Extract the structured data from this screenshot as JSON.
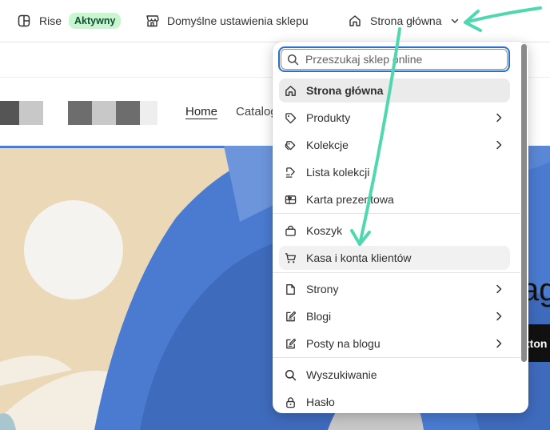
{
  "toolbar": {
    "theme_name": "Rise",
    "theme_badge": "Aktywny",
    "store_settings": "Domyślne ustawienia sklepu",
    "page_selector": "Strona główna"
  },
  "preview": {
    "nav": [
      "Home",
      "Catalog"
    ],
    "hero_title_partial": "ag",
    "hero_button_partial": "tton"
  },
  "dropdown": {
    "search_placeholder": "Przeszukaj sklep online",
    "items": [
      {
        "label": "Strona główna",
        "icon": "home-icon",
        "submenu": false,
        "state": "active"
      },
      {
        "label": "Produkty",
        "icon": "tag-icon",
        "submenu": true
      },
      {
        "label": "Kolekcje",
        "icon": "collection-icon",
        "submenu": true
      },
      {
        "label": "Lista kolekcji",
        "icon": "collection-list-icon",
        "submenu": false
      },
      {
        "label": "Karta prezentowa",
        "icon": "gift-card-icon",
        "submenu": false
      },
      {
        "label": "Koszyk",
        "icon": "bag-icon",
        "submenu": false
      },
      {
        "label": "Kasa i konta klientów",
        "icon": "cart-icon",
        "submenu": false,
        "state": "hover"
      },
      {
        "label": "Strony",
        "icon": "page-icon",
        "submenu": true
      },
      {
        "label": "Blogi",
        "icon": "blog-icon",
        "submenu": true
      },
      {
        "label": "Posty na blogu",
        "icon": "blog-post-icon",
        "submenu": true
      },
      {
        "label": "Wyszukiwanie",
        "icon": "search-icon",
        "submenu": false
      },
      {
        "label": "Hasło",
        "icon": "lock-icon",
        "submenu": false
      }
    ]
  },
  "colors": {
    "accent_focus": "#2c6ecb",
    "badge_bg": "#c9f5d0",
    "annotation_arrow": "#4fd8b0",
    "hero_blue": "#4a7bd0",
    "hero_beige": "#ead8b6"
  }
}
